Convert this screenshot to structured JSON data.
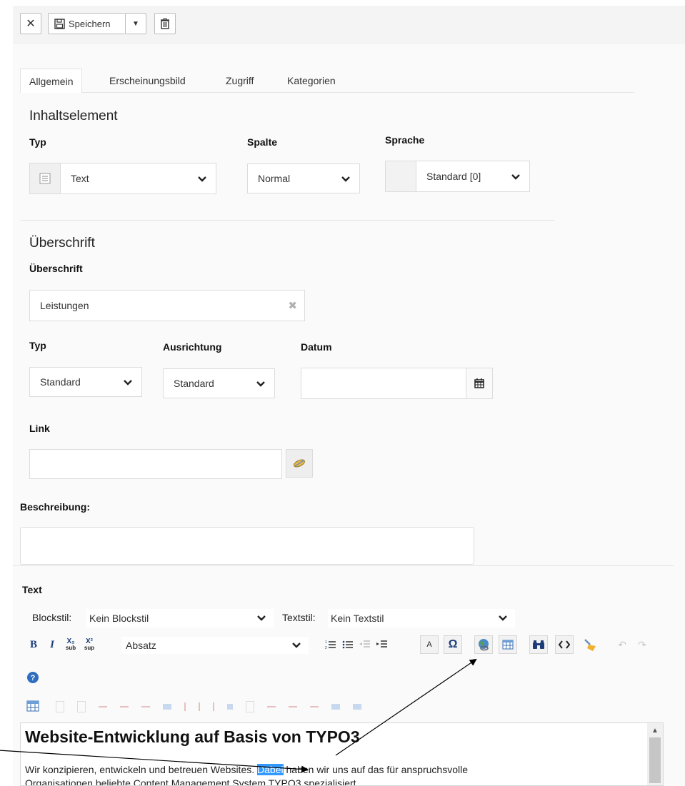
{
  "toolbar": {
    "close_icon": "close-icon",
    "save_label": "Speichern",
    "save_icon": "floppy-disk-icon",
    "dropdown_icon": "caret-down-icon",
    "delete_icon": "trash-icon"
  },
  "tabs": [
    {
      "label": "Allgemein",
      "active": true
    },
    {
      "label": "Erscheinungsbild",
      "active": false
    },
    {
      "label": "Zugriff",
      "active": false
    },
    {
      "label": "Kategorien",
      "active": false
    }
  ],
  "content_element": {
    "section_title": "Inhaltselement",
    "typ_label": "Typ",
    "typ_value": "Text",
    "spalte_label": "Spalte",
    "spalte_value": "Normal",
    "sprache_label": "Sprache",
    "sprache_value": "Standard [0]"
  },
  "header": {
    "section_title": "Überschrift",
    "field_label": "Überschrift",
    "field_value": "Leistungen",
    "typ_label": "Typ",
    "typ_value": "Standard",
    "ausrichtung_label": "Ausrichtung",
    "ausrichtung_value": "Standard",
    "datum_label": "Datum",
    "datum_value": "",
    "link_label": "Link",
    "link_value": ""
  },
  "beschreibung": {
    "label": "Beschreibung:",
    "value": ""
  },
  "text": {
    "label": "Text",
    "blockstil_label": "Blockstil:",
    "blockstil_value": "Kein Blockstil",
    "textstil_label": "Textstil:",
    "textstil_value": "Kein Textstil",
    "format_value": "Absatz",
    "bold_label": "B",
    "italic_label": "I",
    "sub_label": "X₂",
    "sub_caption": "sub",
    "sup_label": "X²",
    "sup_caption": "sup",
    "color_label": "A",
    "omega_label": "Ω",
    "editor_heading": "Website-Entwicklung auf Basis von TYPO3",
    "editor_text_before": "Wir konzipieren, entwickeln und betreuen Websites. ",
    "editor_selected": "Dabei",
    "editor_text_after": " haben wir uns auf das für anspruchsvolle",
    "editor_line2": "Organisationen beliebte Content Management System TYPO3 spezialisiert."
  },
  "colors": {
    "selection": "#3399ff",
    "arrow": "#000000"
  }
}
